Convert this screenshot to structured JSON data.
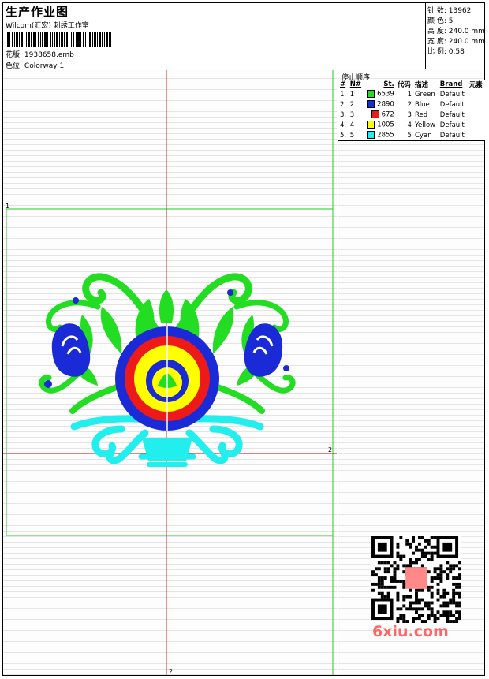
{
  "header": {
    "title": "生产作业图",
    "subtitle": "Wilcom(汇宏) 刺绣工作室",
    "file_label": "花版:",
    "file_value": "1938658.emb",
    "colorway_label": "色位:",
    "colorway_value": "Colorway 1"
  },
  "specs": {
    "stitches": "针 数: 13962",
    "colors": "颜 色: 5",
    "height": "高 度: 240.0 mm",
    "width": "宽 度: 240.0 mm",
    "scale": "比 例: 0.58"
  },
  "stops": {
    "title": "停止顺序:",
    "headers": [
      "#",
      "N#",
      "St.",
      "代码",
      "描述",
      "Brand",
      "元素"
    ],
    "rows": [
      {
        "num": "1.",
        "n": "1",
        "color": "#22dd22",
        "st": "6539",
        "code": "1",
        "desc": "Green",
        "brand": "Default"
      },
      {
        "num": "2.",
        "n": "2",
        "color": "#1a2ad6",
        "st": "2890",
        "code": "2",
        "desc": "Blue",
        "brand": "Default"
      },
      {
        "num": "3.",
        "n": "3",
        "color": "#ee1a1a",
        "st": "672",
        "code": "3",
        "desc": "Red",
        "brand": "Default"
      },
      {
        "num": "4.",
        "n": "4",
        "color": "#ffff00",
        "st": "1005",
        "code": "4",
        "desc": "Yellow",
        "brand": "Default"
      },
      {
        "num": "5.",
        "n": "5",
        "color": "#22eeee",
        "st": "2855",
        "code": "5",
        "desc": "Cyan",
        "brand": "Default"
      }
    ]
  },
  "marks": {
    "one": "1",
    "two": "2"
  },
  "logo": "6xiu.com"
}
